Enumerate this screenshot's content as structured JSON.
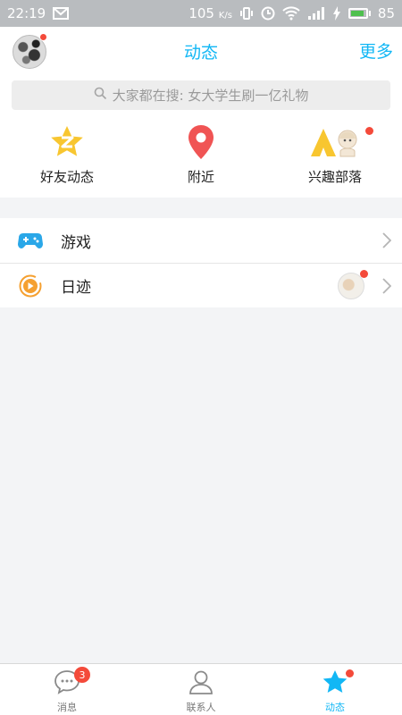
{
  "status_bar": {
    "time": "22:19",
    "speed": "105",
    "speed_unit": "K/s",
    "battery_level": "85"
  },
  "header": {
    "title": "动态",
    "more_label": "更多"
  },
  "search": {
    "placeholder": "大家都在搜: 女大学生刷一亿礼物"
  },
  "shortcuts": [
    {
      "label": "好友动态",
      "icon": "star-z-icon"
    },
    {
      "label": "附近",
      "icon": "location-pin-icon"
    },
    {
      "label": "兴趣部落",
      "icon": "tribe-tent-icon"
    }
  ],
  "list": [
    {
      "label": "游戏",
      "icon": "gamepad-icon"
    },
    {
      "label": "日迹",
      "icon": "play-circle-icon"
    }
  ],
  "bottom_nav": [
    {
      "label": "消息",
      "badge": "3",
      "icon": "chat-bubble-icon"
    },
    {
      "label": "联系人",
      "icon": "contact-person-icon"
    },
    {
      "label": "动态",
      "icon": "star-icon",
      "active": true
    }
  ],
  "colors": {
    "accent": "#12b7f5",
    "badge": "#f44a3a",
    "star_yellow": "#f8c630",
    "pin_red": "#f05454",
    "game_blue": "#2aa7e8",
    "play_orange": "#f5a030"
  }
}
